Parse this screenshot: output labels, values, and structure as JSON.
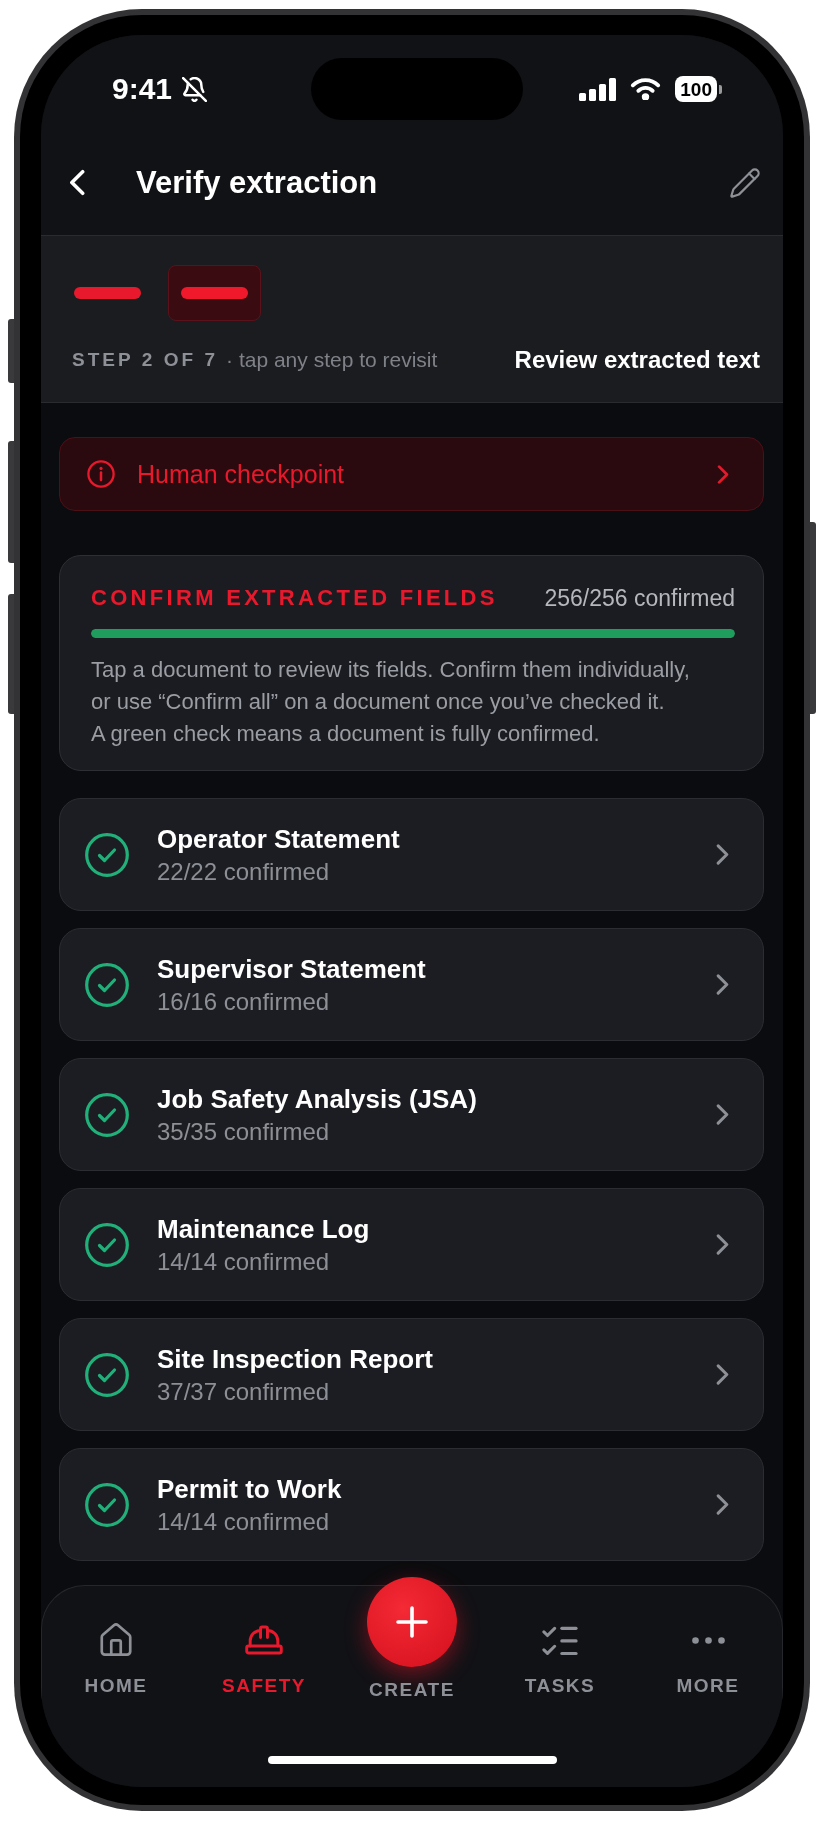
{
  "status_bar": {
    "time": "9:41",
    "silent": true,
    "battery": "100"
  },
  "header": {
    "title": "Verify extraction"
  },
  "stepper": {
    "steps": [
      {
        "selected": false
      },
      {
        "selected": true
      }
    ],
    "position": "STEP 2 OF 7",
    "hint": "· tap any step to revisit",
    "current": "Review extracted text"
  },
  "checkpoint_banner": {
    "label": "Human checkpoint"
  },
  "progress_card": {
    "title": "CONFIRM EXTRACTED FIELDS",
    "count": "256/256 confirmed",
    "level": 1,
    "description": "Tap a document to review its fields. Confirm them individually,\nor use “Confirm all” on a document once you’ve checked it.\nA green check means a document is fully confirmed."
  },
  "documents": [
    {
      "title": "Operator Statement",
      "subtitle": "22/22 confirmed",
      "confirmed": true
    },
    {
      "title": "Supervisor Statement",
      "subtitle": "16/16 confirmed",
      "confirmed": true
    },
    {
      "title": "Job Safety Analysis (JSA)",
      "subtitle": "35/35 confirmed",
      "confirmed": true
    },
    {
      "title": "Maintenance Log",
      "subtitle": "14/14 confirmed",
      "confirmed": true
    },
    {
      "title": "Site Inspection Report",
      "subtitle": "37/37 confirmed",
      "confirmed": true
    },
    {
      "title": "Permit to Work",
      "subtitle": "14/14 confirmed",
      "confirmed": true
    }
  ],
  "tab_bar": [
    {
      "label": "HOME",
      "kind": "tab",
      "selected": false
    },
    {
      "label": "SAFETY",
      "kind": "tab",
      "selected": true
    },
    {
      "label": "CREATE",
      "kind": "action",
      "selected": false
    },
    {
      "label": "TASKS",
      "kind": "tab",
      "selected": false
    },
    {
      "label": "MORE",
      "kind": "tab",
      "selected": false
    }
  ]
}
